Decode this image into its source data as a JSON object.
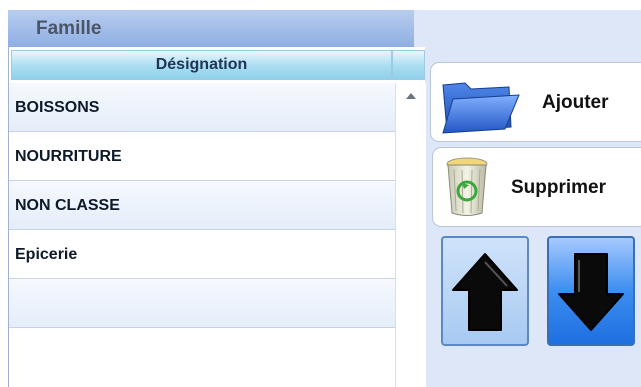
{
  "header": {
    "title": "Famille"
  },
  "table": {
    "column_header": "Désignation",
    "rows": [
      "BOISSONS",
      "NOURRITURE",
      "NON CLASSE",
      "Epicerie",
      ""
    ]
  },
  "buttons": {
    "add_label": "Ajouter",
    "delete_label": "Supprimer",
    "up_icon": "arrow-up-icon",
    "down_icon": "arrow-down-icon"
  },
  "colors": {
    "header_bg": "#8eaee3",
    "panel_bg": "#dde7f7",
    "column_header_bg": "#a9ddf2",
    "up_button_bg": "#b8d4f5",
    "down_button_bg": "#3c8ef0"
  }
}
